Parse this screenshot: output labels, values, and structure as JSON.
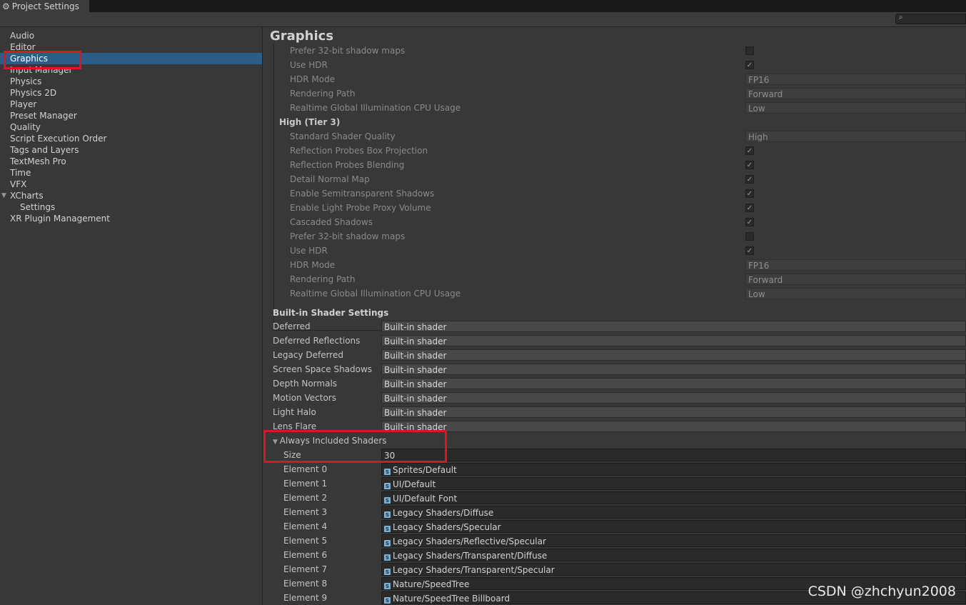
{
  "window": {
    "tab_title": "Project Settings",
    "search_value": ""
  },
  "sidebar": {
    "items": [
      {
        "label": "Audio"
      },
      {
        "label": "Editor"
      },
      {
        "label": "Graphics",
        "selected": true
      },
      {
        "label": "Input Manager"
      },
      {
        "label": "Physics"
      },
      {
        "label": "Physics 2D"
      },
      {
        "label": "Player"
      },
      {
        "label": "Preset Manager"
      },
      {
        "label": "Quality"
      },
      {
        "label": "Script Execution Order"
      },
      {
        "label": "Tags and Layers"
      },
      {
        "label": "TextMesh Pro"
      },
      {
        "label": "Time"
      },
      {
        "label": "VFX"
      },
      {
        "label": "XCharts",
        "expanded": true
      },
      {
        "label": "Settings",
        "child": true
      },
      {
        "label": "XR Plugin Management"
      }
    ]
  },
  "main": {
    "title": "Graphics",
    "tier_top_rows": [
      {
        "label": "Prefer 32-bit shadow maps",
        "kind": "check",
        "checked": false
      },
      {
        "label": "Use HDR",
        "kind": "check",
        "checked": true
      },
      {
        "label": "HDR Mode",
        "kind": "field",
        "value": "FP16"
      },
      {
        "label": "Rendering Path",
        "kind": "field",
        "value": "Forward"
      },
      {
        "label": "Realtime Global Illumination CPU Usage",
        "kind": "field",
        "value": "Low"
      }
    ],
    "tier3": {
      "title": "High (Tier 3)",
      "rows": [
        {
          "label": "Standard Shader Quality",
          "kind": "field",
          "value": "High"
        },
        {
          "label": "Reflection Probes Box Projection",
          "kind": "check",
          "checked": true
        },
        {
          "label": "Reflection Probes Blending",
          "kind": "check",
          "checked": true
        },
        {
          "label": "Detail Normal Map",
          "kind": "check",
          "checked": true
        },
        {
          "label": "Enable Semitransparent Shadows",
          "kind": "check",
          "checked": true
        },
        {
          "label": "Enable Light Probe Proxy Volume",
          "kind": "check",
          "checked": true
        },
        {
          "label": "Cascaded Shadows",
          "kind": "check",
          "checked": true
        },
        {
          "label": "Prefer 32-bit shadow maps",
          "kind": "check",
          "checked": false
        },
        {
          "label": "Use HDR",
          "kind": "check",
          "checked": true
        },
        {
          "label": "HDR Mode",
          "kind": "field",
          "value": "FP16"
        },
        {
          "label": "Rendering Path",
          "kind": "field",
          "value": "Forward"
        },
        {
          "label": "Realtime Global Illumination CPU Usage",
          "kind": "field",
          "value": "Low"
        }
      ]
    },
    "builtin": {
      "title": "Built-in Shader Settings",
      "rows": [
        {
          "label": "Deferred",
          "value": "Built-in shader"
        },
        {
          "label": "Deferred Reflections",
          "value": "Built-in shader"
        },
        {
          "label": "Legacy Deferred",
          "value": "Built-in shader"
        },
        {
          "label": "Screen Space Shadows",
          "value": "Built-in shader"
        },
        {
          "label": "Depth Normals",
          "value": "Built-in shader"
        },
        {
          "label": "Motion Vectors",
          "value": "Built-in shader"
        },
        {
          "label": "Light Halo",
          "value": "Built-in shader"
        },
        {
          "label": "Lens Flare",
          "value": "Built-in shader"
        }
      ]
    },
    "always_included": {
      "title": "Always Included Shaders",
      "size_label": "Size",
      "size": "30",
      "elements": [
        {
          "label": "Element 0",
          "value": "Sprites/Default"
        },
        {
          "label": "Element 1",
          "value": "UI/Default"
        },
        {
          "label": "Element 2",
          "value": "UI/Default Font"
        },
        {
          "label": "Element 3",
          "value": "Legacy Shaders/Diffuse"
        },
        {
          "label": "Element 4",
          "value": "Legacy Shaders/Specular"
        },
        {
          "label": "Element 5",
          "value": "Legacy Shaders/Reflective/Specular"
        },
        {
          "label": "Element 6",
          "value": "Legacy Shaders/Transparent/Diffuse"
        },
        {
          "label": "Element 7",
          "value": "Legacy Shaders/Transparent/Specular"
        },
        {
          "label": "Element 8",
          "value": "Nature/SpeedTree"
        },
        {
          "label": "Element 9",
          "value": "Nature/SpeedTree Billboard"
        }
      ]
    }
  },
  "watermark": "CSDN @zhchyun2008",
  "colors": {
    "selection": "#2c5d87",
    "highlight_box": "#e0141e",
    "background": "#383838"
  }
}
